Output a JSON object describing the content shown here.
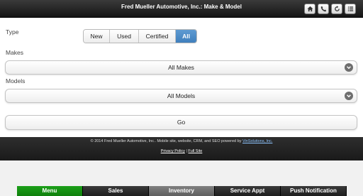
{
  "header": {
    "title": "Fred Mueller Automotive, Inc.: Make & Model",
    "icons": [
      "home-icon",
      "phone-icon",
      "refresh-icon",
      "menu-list-icon"
    ]
  },
  "form": {
    "type_label": "Type",
    "type_options": [
      "New",
      "Used",
      "Certified",
      "All"
    ],
    "type_selected": "All",
    "makes_label": "Makes",
    "makes_value": "All Makes",
    "models_label": "Models",
    "models_value": "All Models",
    "go_label": "Go"
  },
  "footer": {
    "copyright": "© 2014 Fred Mueller Automotive, Inc.. Mobile site, website, CRM, and SEO powered by ",
    "vendor_link": "VinSolutions, Inc.",
    "privacy_link": "Privacy Policy",
    "separator": " | ",
    "full_site_link": "Full Site"
  },
  "tabs": [
    "Menu",
    "Sales",
    "Inventory",
    "Service Appt",
    "Push Notification"
  ],
  "colors": {
    "active_segment": "#4f8ac6",
    "menu_tab": "#139015",
    "inventory_tab": "#707070"
  }
}
